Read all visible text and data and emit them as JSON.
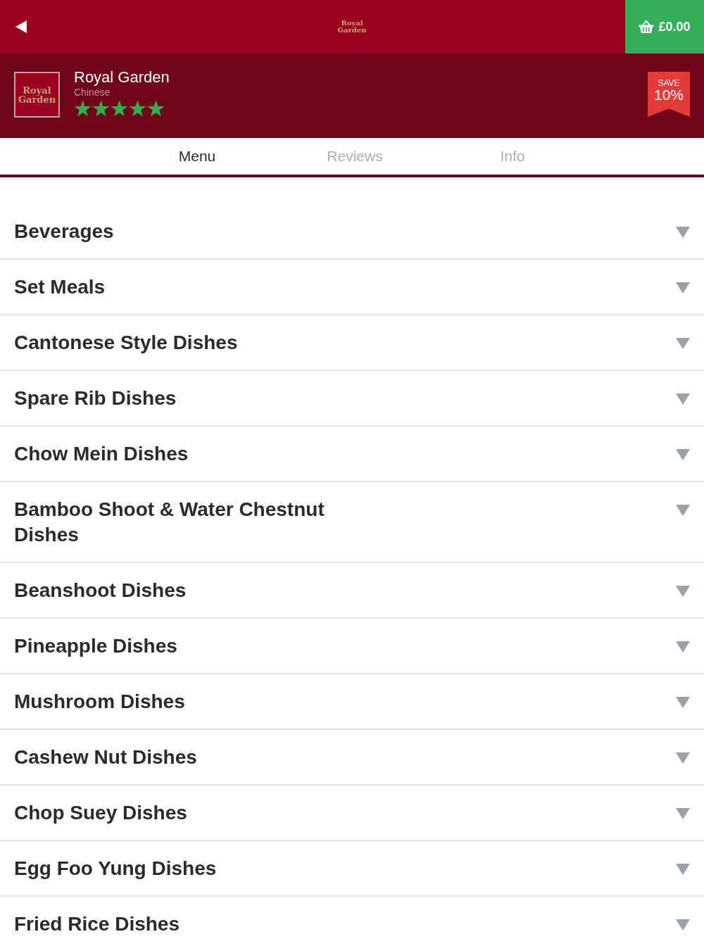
{
  "top_bar": {
    "logo_lines": [
      "Royal",
      "Garden"
    ],
    "cart_total": "£0.00"
  },
  "restaurant": {
    "logo_lines": [
      "Royal",
      "Garden"
    ],
    "name": "Royal Garden",
    "cuisine": "Chinese",
    "stars": 5,
    "offer": {
      "label": "SAVE",
      "value": "10%"
    }
  },
  "tabs": [
    {
      "label": "Menu",
      "selected": true
    },
    {
      "label": "Reviews",
      "selected": false
    },
    {
      "label": "Info",
      "selected": false
    }
  ],
  "categories": [
    {
      "name": "Beverages",
      "expanded": false
    },
    {
      "name": "Set Meals",
      "expanded": false
    },
    {
      "name": "Cantonese Style Dishes",
      "expanded": false
    },
    {
      "name": "Spare Rib Dishes",
      "expanded": false
    },
    {
      "name": "Chow Mein Dishes",
      "expanded": false
    },
    {
      "name": "Bamboo Shoot & Water Chestnut Dishes",
      "expanded": false
    },
    {
      "name": "Beanshoot Dishes",
      "expanded": false
    },
    {
      "name": "Pineapple Dishes",
      "expanded": false
    },
    {
      "name": "Mushroom Dishes",
      "expanded": false
    },
    {
      "name": "Cashew Nut Dishes",
      "expanded": false
    },
    {
      "name": "Chop Suey Dishes",
      "expanded": false
    },
    {
      "name": "Egg Foo Yung Dishes",
      "expanded": false
    },
    {
      "name": "Fried Rice Dishes",
      "expanded": false
    }
  ]
}
